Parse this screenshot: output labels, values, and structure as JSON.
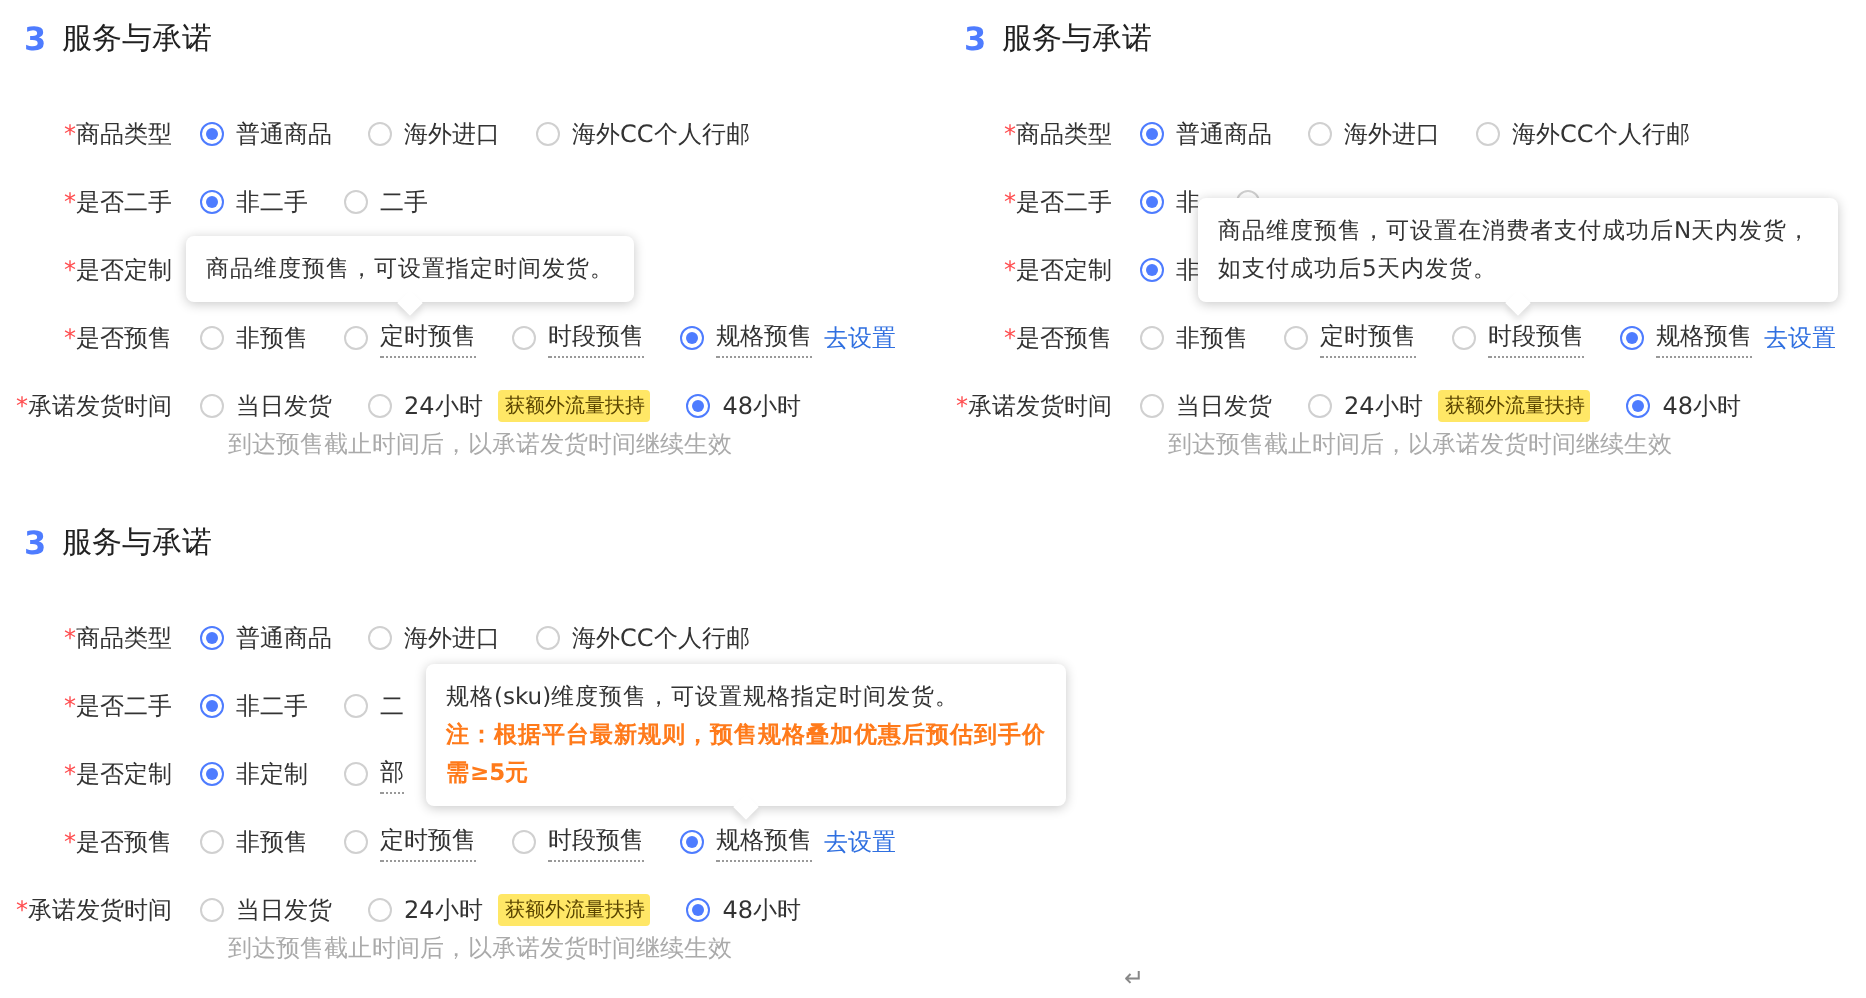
{
  "panels": [
    {
      "number": "3",
      "title": "服务与承诺",
      "rows": [
        {
          "mark": "*",
          "label": "商品类型",
          "options": [
            {
              "label": "普通商品",
              "selected": true
            },
            {
              "label": "海外进口",
              "selected": false
            },
            {
              "label": "海外CC个人行邮",
              "selected": false
            }
          ]
        },
        {
          "mark": "*",
          "label": "是否二手",
          "options": [
            {
              "label": "非二手",
              "selected": true
            },
            {
              "label": "二手",
              "selected": false
            }
          ]
        },
        {
          "mark": "*",
          "label": "是否定制",
          "options": []
        },
        {
          "mark": "*",
          "label": "是否预售",
          "options": [
            {
              "label": "非预售",
              "selected": false
            },
            {
              "label": "定时预售",
              "selected": false,
              "dotted": true,
              "tooltip": [
                {
                  "text": "商品维度预售，可设置指定时间发货。",
                  "warning": false
                }
              ]
            },
            {
              "label": "时段预售",
              "selected": false,
              "dotted": true
            },
            {
              "label": "规格预售",
              "selected": true,
              "dotted": true
            }
          ],
          "link": "去设置"
        },
        {
          "mark": "*",
          "label": "承诺发货时间",
          "options": [
            {
              "label": "当日发货",
              "selected": false
            },
            {
              "label": "24小时",
              "selected": false,
              "badge": "获额外流量扶持"
            },
            {
              "label": "48小时",
              "selected": true
            }
          ],
          "hint": "到达预售截止时间后，以承诺发货时间继续生效"
        }
      ]
    },
    {
      "number": "3",
      "title": "服务与承诺",
      "rows": [
        {
          "mark": "*",
          "label": "商品类型",
          "options": [
            {
              "label": "普通商品",
              "selected": true
            },
            {
              "label": "海外进口",
              "selected": false
            },
            {
              "label": "海外CC个人行邮",
              "selected": false
            }
          ]
        },
        {
          "mark": "*",
          "label": "是否二手",
          "options": [
            {
              "label": "非",
              "selected": true
            },
            {
              "selected": false
            }
          ]
        },
        {
          "mark": "*",
          "label": "是否定制",
          "options": [
            {
              "label": "非",
              "selected": true
            }
          ]
        },
        {
          "mark": "*",
          "label": "是否预售",
          "options": [
            {
              "label": "非预售",
              "selected": false
            },
            {
              "label": "定时预售",
              "selected": false,
              "dotted": true
            },
            {
              "label": "时段预售",
              "selected": false,
              "dotted": true,
              "tooltip": [
                {
                  "text": "商品维度预售，可设置在消费者支付成功后N天内发货，如支付成功后5天内发货。",
                  "warning": false
                }
              ]
            },
            {
              "label": "规格预售",
              "selected": true,
              "dotted": true
            }
          ],
          "link": "去设置"
        },
        {
          "mark": "*",
          "label": "承诺发货时间",
          "options": [
            {
              "label": "当日发货",
              "selected": false
            },
            {
              "label": "24小时",
              "selected": false,
              "badge": "获额外流量扶持"
            },
            {
              "label": "48小时",
              "selected": true
            }
          ],
          "hint": "到达预售截止时间后，以承诺发货时间继续生效"
        }
      ]
    },
    {
      "number": "3",
      "title": "服务与承诺",
      "rows": [
        {
          "mark": "*",
          "label": "商品类型",
          "options": [
            {
              "label": "普通商品",
              "selected": true
            },
            {
              "label": "海外进口",
              "selected": false
            },
            {
              "label": "海外CC个人行邮",
              "selected": false
            }
          ]
        },
        {
          "mark": "*",
          "label": "是否二手",
          "options": [
            {
              "label": "非二手",
              "selected": true
            },
            {
              "label": "二",
              "selected": false
            }
          ]
        },
        {
          "mark": "*",
          "label": "是否定制",
          "options": [
            {
              "label": "非定制",
              "selected": true
            },
            {
              "label": "部",
              "selected": false,
              "dotted": true
            }
          ]
        },
        {
          "mark": "*",
          "label": "是否预售",
          "options": [
            {
              "label": "非预售",
              "selected": false
            },
            {
              "label": "定时预售",
              "selected": false,
              "dotted": true
            },
            {
              "label": "时段预售",
              "selected": false,
              "dotted": true
            },
            {
              "label": "规格预售",
              "selected": true,
              "dotted": true,
              "tooltip": [
                {
                  "text": "规格(sku)维度预售，可设置规格指定时间发货。",
                  "warning": false
                },
                {
                  "text": "注：根据平台最新规则，预售规格叠加优惠后预估到手价需≥5元",
                  "warning": true
                }
              ]
            }
          ],
          "link": "去设置"
        },
        {
          "mark": "*",
          "label": "承诺发货时间",
          "options": [
            {
              "label": "当日发货",
              "selected": false
            },
            {
              "label": "24小时",
              "selected": false,
              "badge": "获额外流量扶持"
            },
            {
              "label": "48小时",
              "selected": true
            }
          ],
          "hint": "到达预售截止时间后，以承诺发货时间继续生效"
        }
      ]
    }
  ],
  "return_mark": "↵"
}
